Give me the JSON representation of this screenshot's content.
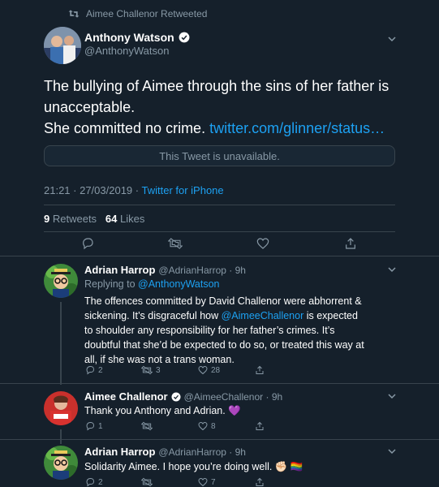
{
  "retweet_context": {
    "label": "Aimee Challenor Retweeted"
  },
  "main_tweet": {
    "author_name": "Anthony Watson",
    "author_handle": "@AnthonyWatson",
    "text_line1": "The bullying of Aimee through the sins of her father is",
    "text_line2": "unacceptable.",
    "text_line3_prefix": "She committed no crime. ",
    "link": "twitter.com/glinner/status…",
    "quoted_notice": "This Tweet is unavailable.",
    "timestamp": "21:21 · 27/03/2019",
    "source_sep": " · ",
    "source": "Twitter for iPhone",
    "retweets_count": "9",
    "retweets_label": "Retweets",
    "likes_count": "64",
    "likes_label": "Likes"
  },
  "replies": [
    {
      "author_name": "Adrian Harrop",
      "author_handle": "@AdrianHarrop · 9h",
      "replying_prefix": "Replying to ",
      "replying_to": "@AnthonyWatson",
      "text_a": "The offences committed by David Challenor were abhorrent & sickening. It’s disgraceful how ",
      "mention": "@AimeeChallenor",
      "text_b": " is expected to shoulder any responsibility for her father’s crimes. It’s doubtful that she’d be expected to do so, or treated this way at all, if she was not a trans woman.",
      "reply_count": "2",
      "retweet_count": "3",
      "like_count": "28"
    },
    {
      "author_name": "Aimee Challenor",
      "author_handle": "@AimeeChallenor · 9h",
      "text": "Thank you Anthony and Adrian. 💜",
      "reply_count": "1",
      "retweet_count": "",
      "like_count": "8"
    },
    {
      "author_name": "Adrian Harrop",
      "author_handle": "@AdrianHarrop · 9h",
      "text": "Solidarity Aimee. I hope you’re doing well. ✊🏻 🏳️‍🌈",
      "reply_count": "2",
      "retweet_count": "",
      "like_count": "7"
    }
  ],
  "colors": {
    "background": "#15202b",
    "accent": "#1da1f2",
    "muted": "#8899a6",
    "border": "#38444d"
  },
  "icons": [
    "retweet-icon",
    "verified-badge-icon",
    "chevron-down-icon",
    "reply-icon",
    "like-icon",
    "share-icon",
    "purple-heart-emoji",
    "raised-fist-emoji",
    "rainbow-flag-emoji"
  ]
}
